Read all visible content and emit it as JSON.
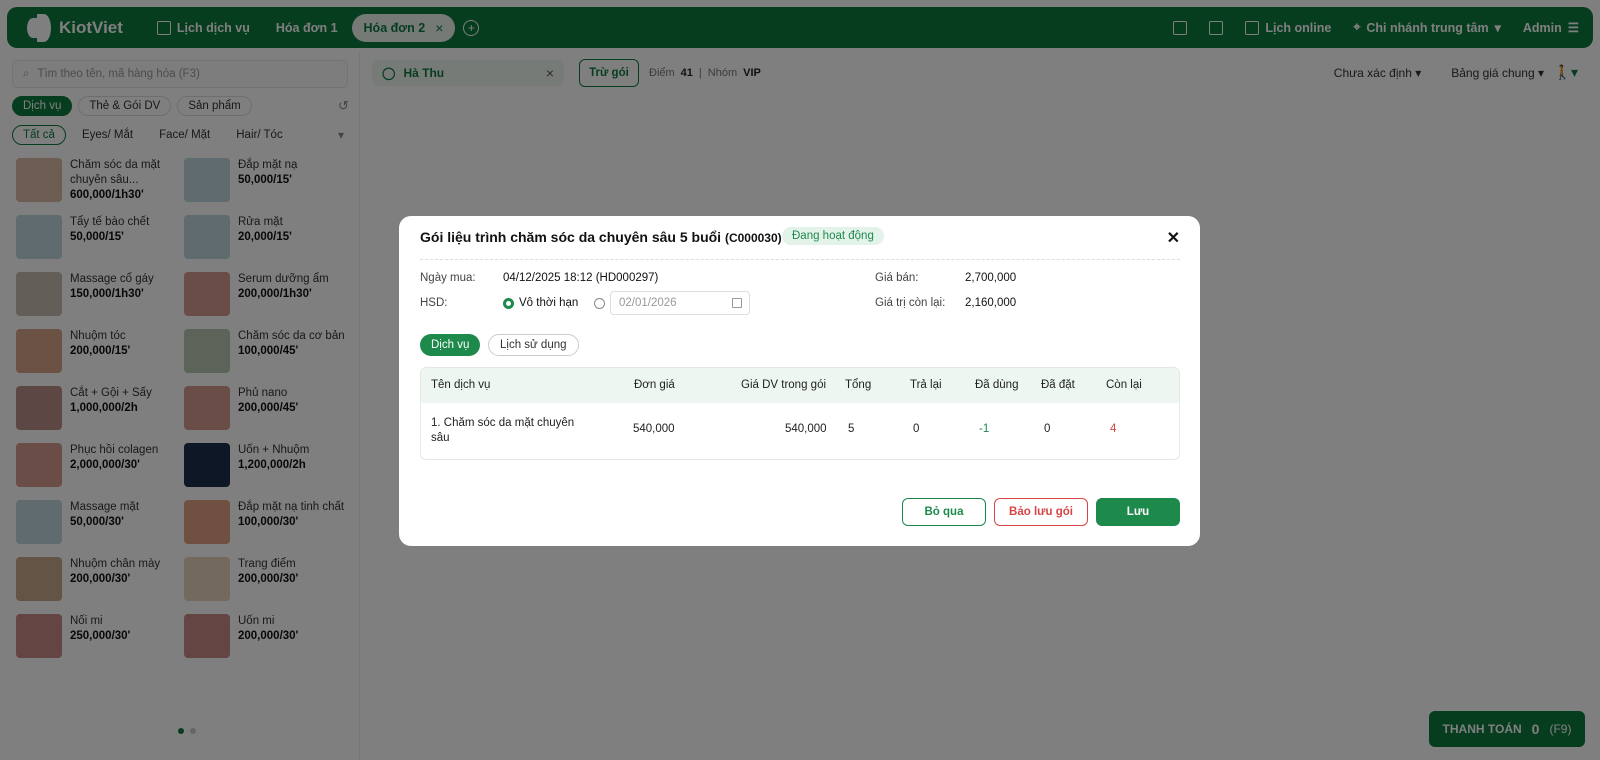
{
  "app": {
    "name": "KiotViet"
  },
  "tabs": [
    {
      "label": "Lịch dịch vụ"
    },
    {
      "label": "Hóa đơn 1"
    },
    {
      "label": "Hóa đơn 2"
    }
  ],
  "header": {
    "online_label": "Lịch online",
    "branch_label": "Chi nhánh trung tâm",
    "user_label": "Admin"
  },
  "search": {
    "placeholder": "Tìm theo tên, mã hàng hóa (F3)"
  },
  "categories": [
    "Dịch vụ",
    "Thẻ & Gói DV",
    "Sản phẩm"
  ],
  "filters": [
    "Tất cả",
    "Eyes/ Mắt",
    "Face/ Mặt",
    "Hair/ Tóc"
  ],
  "products": [
    {
      "name": "Chăm sóc da mặt chuyên sâu...",
      "price": "600,000/1h30'",
      "color": "#d9b9a4"
    },
    {
      "name": "Đắp mặt nạ",
      "price": "50,000/15'",
      "color": "#bfd6dc"
    },
    {
      "name": "Tẩy tế bào chết",
      "price": "50,000/15'",
      "color": "#bfd6dc"
    },
    {
      "name": "Rửa mặt",
      "price": "20,000/15'",
      "color": "#bfd6dc"
    },
    {
      "name": "Massage cổ gáy",
      "price": "150,000/1h30'",
      "color": "#c8bdb2"
    },
    {
      "name": "Serum dưỡng ẩm",
      "price": "200,000/1h30'",
      "color": "#d59b8e"
    },
    {
      "name": "Nhuộm tóc",
      "price": "200,000/15'",
      "color": "#d8a58a"
    },
    {
      "name": "Chăm sóc da cơ bản",
      "price": "100,000/45'",
      "color": "#b9c9b4"
    },
    {
      "name": "Cắt + Gội + Sấy",
      "price": "1,000,000/2h",
      "color": "#b98f8a"
    },
    {
      "name": "Phủ nano",
      "price": "200,000/45'",
      "color": "#d59b8e"
    },
    {
      "name": "Phục hồi colagen",
      "price": "2,000,000/30'",
      "color": "#d59b8e"
    },
    {
      "name": "Uốn + Nhuộm",
      "price": "1,200,000/2h",
      "color": "#1d2f4a"
    },
    {
      "name": "Massage mặt",
      "price": "50,000/30'",
      "color": "#bfd6dc"
    },
    {
      "name": "Đắp mặt nạ tinh chất",
      "price": "100,000/30'",
      "color": "#e0a080"
    },
    {
      "name": "Nhuộm chân mày",
      "price": "200,000/30'",
      "color": "#c9a98a"
    },
    {
      "name": "Trang điểm",
      "price": "200,000/30'",
      "color": "#e7d2b8"
    },
    {
      "name": "Nối mi",
      "price": "250,000/30'",
      "color": "#c98a88"
    },
    {
      "name": "Uốn mi",
      "price": "200,000/30'",
      "color": "#c98a88"
    }
  ],
  "customer": {
    "name": "Hà Thu",
    "deduct_label": "Trừ gói",
    "points_label": "Điểm",
    "points_value": "41",
    "group_label": "Nhóm",
    "group_value": "VIP"
  },
  "selects": {
    "status": "Chưa xác định",
    "price_list": "Bảng giá chung"
  },
  "payment": {
    "label": "THANH TOÁN",
    "amount": "0",
    "shortcut": "(F9)"
  },
  "modal": {
    "title": "Gói liệu trình chăm sóc da chuyên sâu 5 buổi",
    "code": "(C000030)",
    "status": "Đang hoạt động",
    "purchase_label": "Ngày mua:",
    "purchase_value": "04/12/2025 18:12 (HD000297)",
    "expiry_label": "HSD:",
    "unlimited_label": "Vô thời hạn",
    "date_value": "02/01/2026",
    "price_label": "Giá bán:",
    "price_value": "2,700,000",
    "remaining_value_label": "Giá trị còn lại:",
    "remaining_value": "2,160,000",
    "tabs": [
      "Dịch vụ",
      "Lịch sử dụng"
    ],
    "columns": [
      "Tên dịch vụ",
      "Đơn giá",
      "Giá DV trong gói",
      "Tổng",
      "Trả lại",
      "Đã dùng",
      "Đã đặt",
      "Còn lại"
    ],
    "rows": [
      {
        "name": "1. Chăm sóc da mặt chuyên sâu",
        "unit_price": "540,000",
        "pkg_price": "540,000",
        "total": "5",
        "returned": "0",
        "used": "-1",
        "booked": "0",
        "remaining": "4"
      }
    ],
    "buttons": {
      "skip": "Bỏ qua",
      "reserve": "Bảo lưu gói",
      "save": "Lưu"
    }
  }
}
